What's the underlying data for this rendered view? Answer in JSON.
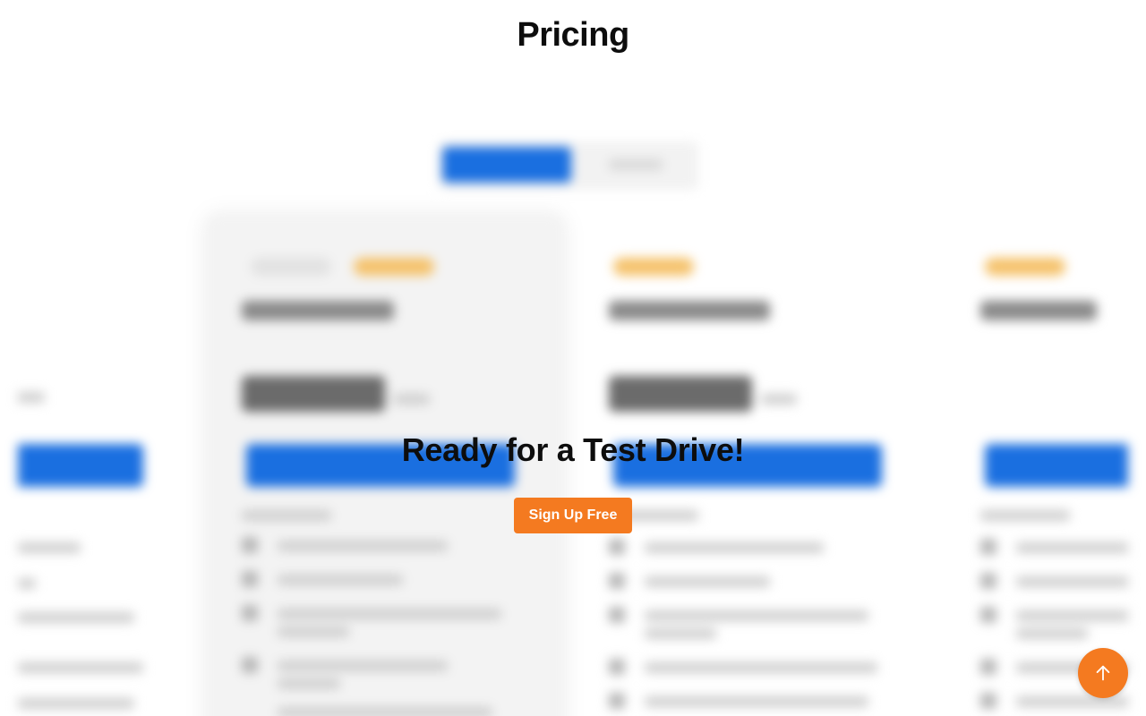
{
  "header": {
    "title": "Pricing"
  },
  "overlay": {
    "title": "Ready for a Test Drive!",
    "cta_label": "Sign Up Free"
  },
  "scroll_top": {
    "icon": "arrow-up-icon"
  },
  "colors": {
    "accent_orange": "#f47a20",
    "primary_blue": "#1a6fe0",
    "badge_yellow": "#f5c26b"
  }
}
